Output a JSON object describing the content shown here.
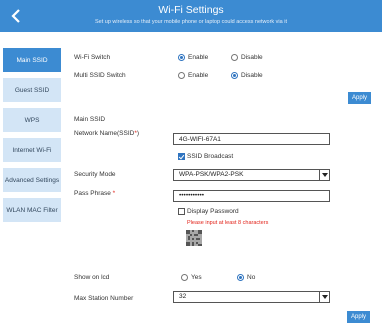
{
  "header": {
    "title": "Wi-Fi Settings",
    "subtitle": "Set up wireless so that your mobile phone or laptop could access network via it",
    "accent_color": "#3c8bd2",
    "back_icon": "chevron-left-icon"
  },
  "sidebar": {
    "items": [
      {
        "label": "Main SSID",
        "active": true
      },
      {
        "label": "Guest SSID",
        "active": false
      },
      {
        "label": "WPS",
        "active": false
      },
      {
        "label": "Internet Wi-Fi",
        "active": false
      },
      {
        "label": "Advanced Settings",
        "active": false
      },
      {
        "label": "WLAN MAC Filter",
        "active": false
      }
    ]
  },
  "wifi_switch": {
    "label": "Wi-Fi Switch",
    "enable": "Enable",
    "disable": "Disable",
    "selected": "Enable"
  },
  "multi_ssid": {
    "label": "Multi SSID Switch",
    "enable": "Enable",
    "disable": "Disable",
    "selected": "Disable"
  },
  "apply_label": "Apply",
  "main_ssid": {
    "section_title": "Main SSID",
    "network_name_label": "Network Name(SSID",
    "network_name_suffix": ")",
    "required_mark": "*",
    "network_name_value": "4G-WIFI-67A1",
    "ssid_broadcast_label": "SSID Broadcast",
    "ssid_broadcast_checked": true,
    "security_mode_label": "Security Mode",
    "security_mode_value": "WPA-PSK/WPA2-PSK",
    "pass_phrase_label": "Pass Phrase",
    "pass_phrase_mask": "•••••••••••",
    "display_password_label": "Display Password",
    "display_password_checked": false,
    "password_hint": "Please input at least 8 characters",
    "qr_icon": "qr-code-icon",
    "show_on_lcd_label": "Show on lcd",
    "show_on_lcd_yes": "Yes",
    "show_on_lcd_no": "No",
    "show_on_lcd_selected": "No",
    "max_station_label": "Max Station Number",
    "max_station_value": "32"
  }
}
